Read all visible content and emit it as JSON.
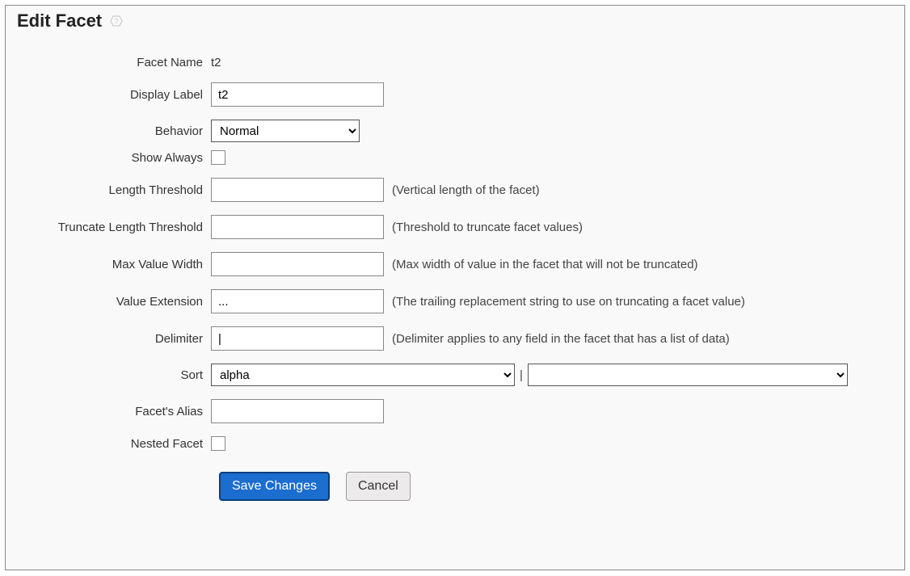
{
  "title": "Edit Facet",
  "labels": {
    "facetName": "Facet Name",
    "displayLabel": "Display Label",
    "behavior": "Behavior",
    "showAlways": "Show Always",
    "lengthThreshold": "Length Threshold",
    "truncateLengthThreshold": "Truncate Length Threshold",
    "maxValueWidth": "Max Value Width",
    "valueExtension": "Value Extension",
    "delimiter": "Delimiter",
    "sort": "Sort",
    "facetsAlias": "Facet's Alias",
    "nestedFacet": "Nested Facet"
  },
  "values": {
    "facetNameStatic": "t2",
    "displayLabel": "t2",
    "behavior": "Normal",
    "lengthThreshold": "",
    "truncateLengthThreshold": "",
    "maxValueWidth": "",
    "valueExtension": "...",
    "delimiter": "|",
    "sort": "alpha",
    "sort2": "",
    "facetsAlias": ""
  },
  "hints": {
    "lengthThreshold": "(Vertical length of the facet)",
    "truncateLengthThreshold": "(Threshold to truncate facet values)",
    "maxValueWidth": "(Max width of value in the facet that will not be truncated)",
    "valueExtension": "(The trailing replacement string to use on truncating a facet value)",
    "delimiter": "(Delimiter applies to any field in the facet that has a list of data)"
  },
  "buttons": {
    "save": "Save Changes",
    "cancel": "Cancel"
  },
  "sortSeparator": "|"
}
